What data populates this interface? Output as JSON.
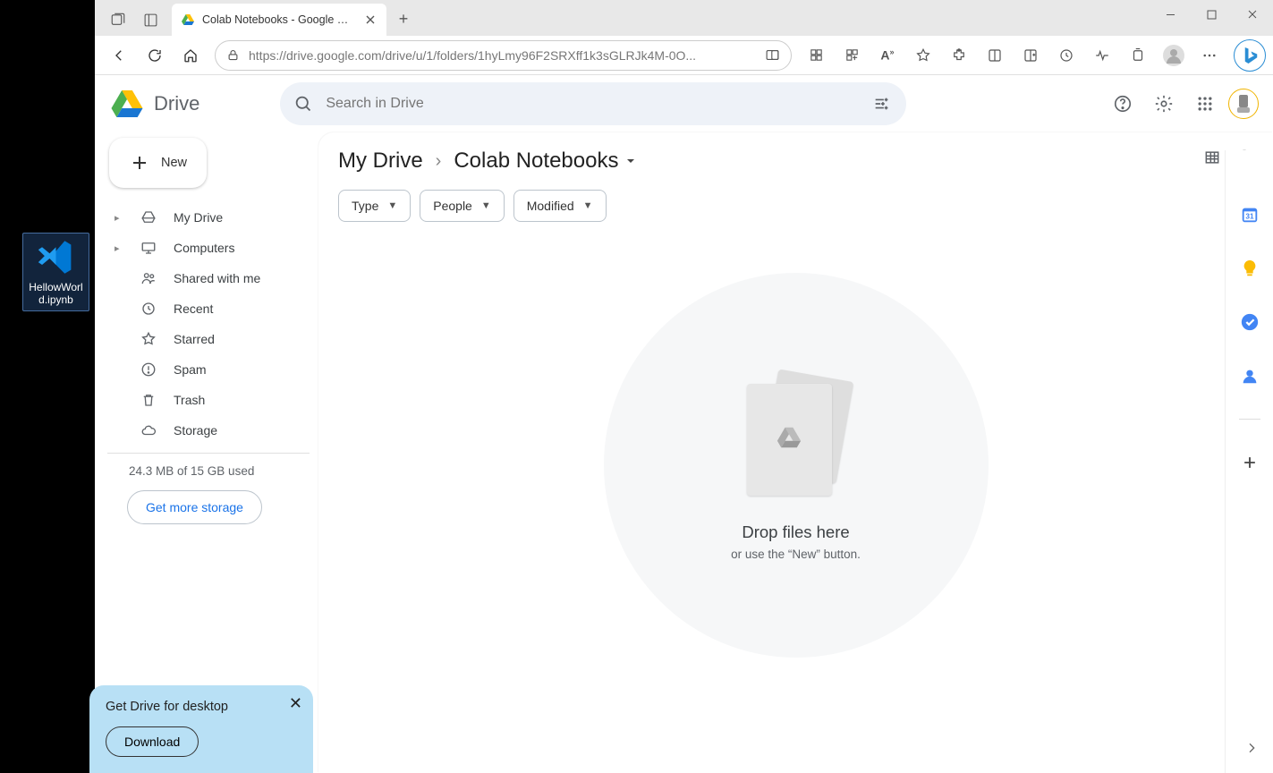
{
  "desktop": {
    "file_label": "HellowWorld.ipynb"
  },
  "browser": {
    "tab_title": "Colab Notebooks - Google Drive",
    "url_display": "https://drive.google.com/drive/u/1/folders/1hyLmy96F2SRXff1k3sGLRJk4M-0O..."
  },
  "drive": {
    "app_name": "Drive",
    "search_placeholder": "Search in Drive",
    "new_button": "New",
    "nav": {
      "my_drive": "My Drive",
      "computers": "Computers",
      "shared": "Shared with me",
      "recent": "Recent",
      "starred": "Starred",
      "spam": "Spam",
      "trash": "Trash",
      "storage": "Storage"
    },
    "storage_used": "24.3 MB of 15 GB used",
    "more_storage": "Get more storage",
    "promo": {
      "title": "Get Drive for desktop",
      "button": "Download"
    },
    "breadcrumb": {
      "root": "My Drive",
      "current": "Colab Notebooks"
    },
    "filters": {
      "type": "Type",
      "people": "People",
      "modified": "Modified"
    },
    "empty": {
      "title": "Drop files here",
      "subtitle": "or use the “New” button."
    }
  }
}
